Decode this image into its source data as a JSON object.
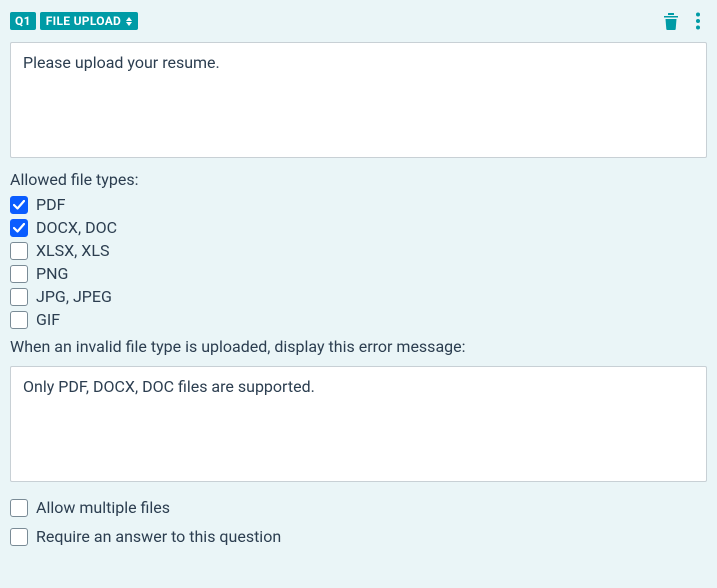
{
  "header": {
    "question_number": "Q1",
    "question_type": "FILE UPLOAD"
  },
  "question_text": "Please upload your resume.",
  "allowed_types_label": "Allowed file types:",
  "file_types": [
    {
      "label": "PDF",
      "checked": true
    },
    {
      "label": "DOCX, DOC",
      "checked": true
    },
    {
      "label": "XLSX, XLS",
      "checked": false
    },
    {
      "label": "PNG",
      "checked": false
    },
    {
      "label": "JPG, JPEG",
      "checked": false
    },
    {
      "label": "GIF",
      "checked": false
    }
  ],
  "error_label": "When an invalid file type is uploaded, display this error message:",
  "error_message": "Only PDF, DOCX, DOC files are supported.",
  "options": {
    "allow_multiple": {
      "label": "Allow multiple files",
      "checked": false
    },
    "require_answer": {
      "label": "Require an answer to this question",
      "checked": false
    }
  }
}
